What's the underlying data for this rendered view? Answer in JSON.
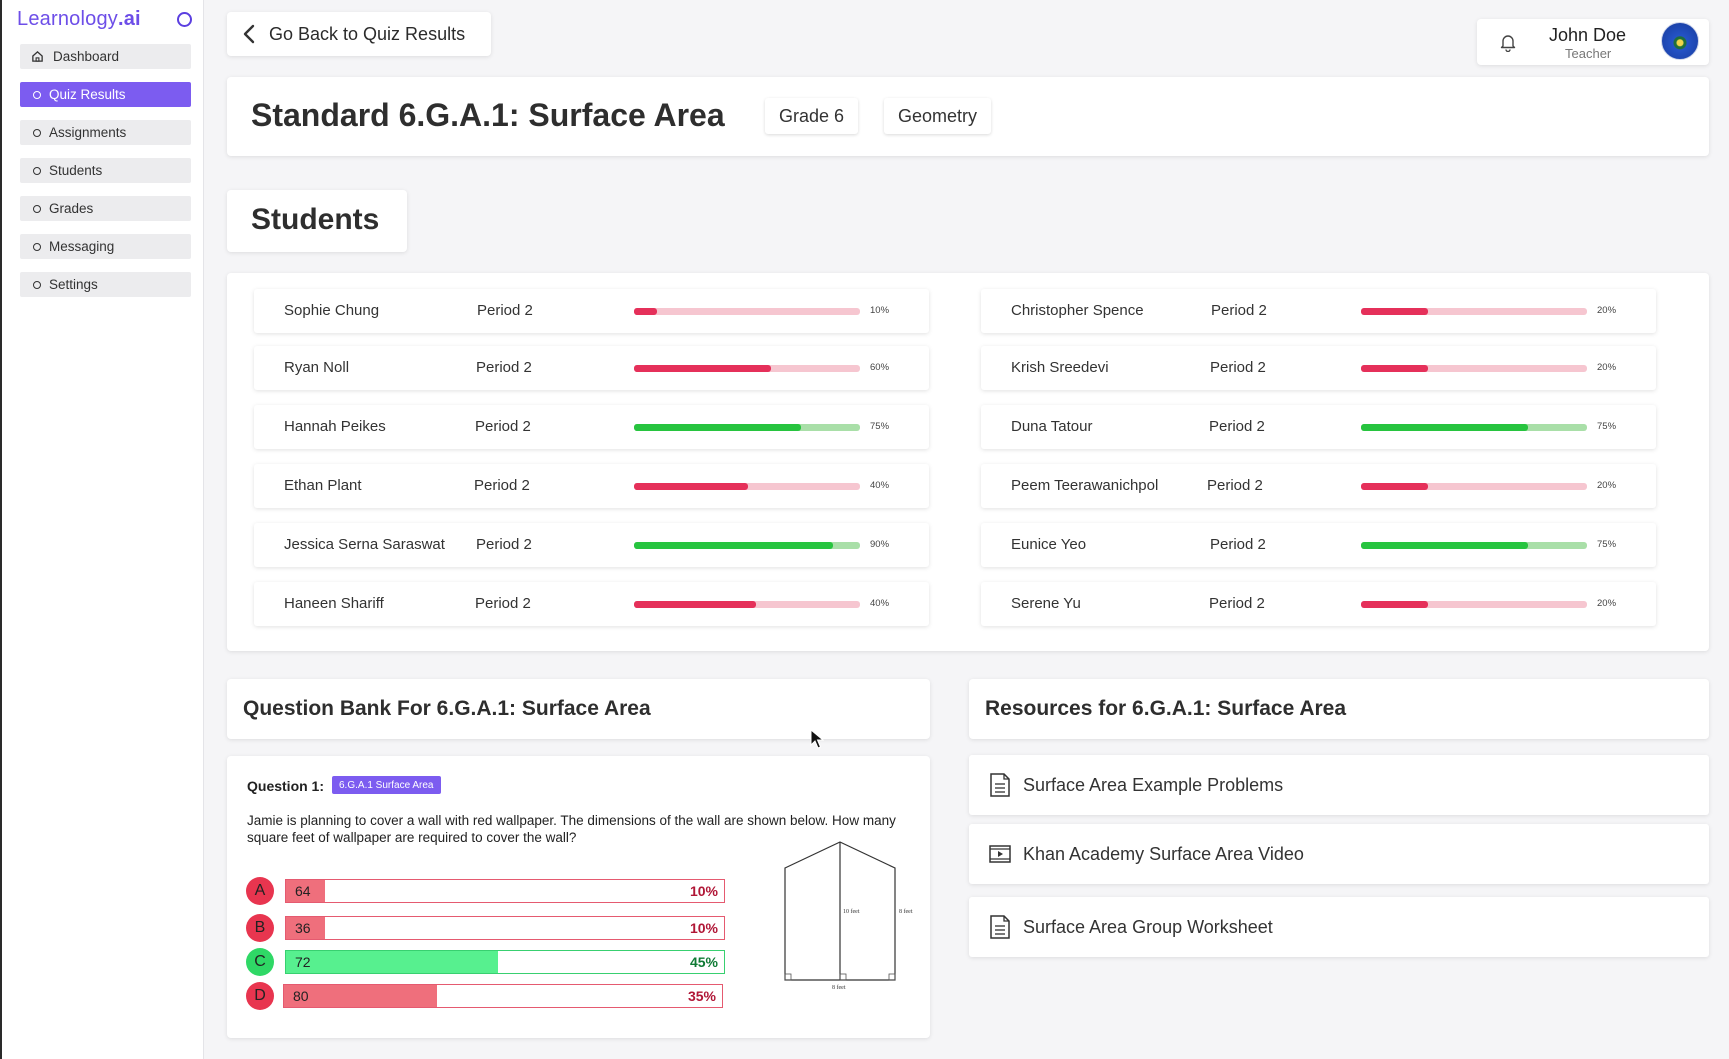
{
  "app": {
    "logo_main": "Learnology",
    "logo_suffix": ".ai"
  },
  "sidebar": {
    "items": [
      {
        "label": "Dashboard",
        "icon": "home-icon",
        "active": false
      },
      {
        "label": "Quiz Results",
        "icon": "circle-icon",
        "active": true
      },
      {
        "label": "Assignments",
        "icon": "circle-icon",
        "active": false
      },
      {
        "label": "Students",
        "icon": "circle-icon",
        "active": false
      },
      {
        "label": "Grades",
        "icon": "circle-icon",
        "active": false
      },
      {
        "label": "Messaging",
        "icon": "circle-icon",
        "active": false
      },
      {
        "label": "Settings",
        "icon": "circle-icon",
        "active": false
      }
    ]
  },
  "header": {
    "back_label": "Go Back to Quiz Results",
    "user_name": "John Doe",
    "user_role": "Teacher"
  },
  "standard": {
    "title": "Standard 6.G.A.1: Surface Area",
    "chips": [
      "Grade 6",
      "Geometry"
    ]
  },
  "students_title": "Students",
  "students": [
    {
      "name": "Sophie Chung",
      "period": "Period 2",
      "score": 10,
      "label": "10%",
      "status": "red"
    },
    {
      "name": "Ryan Noll",
      "period": "Period 2",
      "score": 60,
      "label": "60%",
      "status": "red"
    },
    {
      "name": "Hannah Peikes",
      "period": "Period 2",
      "score": 75,
      "label": "75%",
      "status": "green"
    },
    {
      "name": "Ethan Plant",
      "period": "Period 2",
      "score": 40,
      "label": "40%",
      "status": "red"
    },
    {
      "name": "Jessica Serna Saraswat",
      "period": "Period 2",
      "score": 90,
      "label": "90%",
      "status": "green"
    },
    {
      "name": "Haneen Shariff",
      "period": "Period 2",
      "score": 40,
      "label": "40%",
      "status": "red"
    },
    {
      "name": "Christopher Spence",
      "period": "Period 2",
      "score": 20,
      "label": "20%",
      "status": "red"
    },
    {
      "name": "Krish Sreedevi",
      "period": "Period 2",
      "score": 20,
      "label": "20%",
      "status": "red"
    },
    {
      "name": "Duna Tatour",
      "period": "Period 2",
      "score": 75,
      "label": "75%",
      "status": "green"
    },
    {
      "name": "Peem Teerawanichpol",
      "period": "Period 2",
      "score": 20,
      "label": "20%",
      "status": "red"
    },
    {
      "name": "Eunice Yeo",
      "period": "Period 2",
      "score": 75,
      "label": "75%",
      "status": "green"
    },
    {
      "name": "Serene Yu",
      "period": "Period 2",
      "score": 20,
      "label": "20%",
      "status": "red"
    }
  ],
  "question_bank": {
    "title": "Question Bank For 6.G.A.1: Surface Area",
    "question_label": "Question 1:",
    "tag": "6.G.A.1 Surface Area",
    "text": "Jamie is planning to cover a wall with red wallpaper. The dimensions of the wall are shown below. How many square feet of wallpaper are required to cover the wall?",
    "options": [
      {
        "letter": "A",
        "value": "64",
        "percent": 10,
        "label": "10%",
        "correct": false
      },
      {
        "letter": "B",
        "value": "36",
        "percent": 10,
        "label": "10%",
        "correct": false
      },
      {
        "letter": "C",
        "value": "72",
        "percent": 45,
        "label": "45%",
        "correct": true
      },
      {
        "letter": "D",
        "value": "80",
        "percent": 35,
        "label": "35%",
        "correct": false
      }
    ],
    "figure_labels": {
      "height": "10 feet",
      "side": "8 feet",
      "base": "8 feet"
    }
  },
  "resources": {
    "title": "Resources for 6.G.A.1: Surface Area",
    "items": [
      {
        "label": "Surface Area Example Problems",
        "icon": "document-icon"
      },
      {
        "label": "Khan Academy Surface Area Video",
        "icon": "video-icon"
      },
      {
        "label": "Surface Area Group Worksheet",
        "icon": "document-icon"
      }
    ]
  },
  "colors": {
    "accent": "#7c5cf0",
    "low": "#e5305a",
    "high": "#27c43f"
  }
}
